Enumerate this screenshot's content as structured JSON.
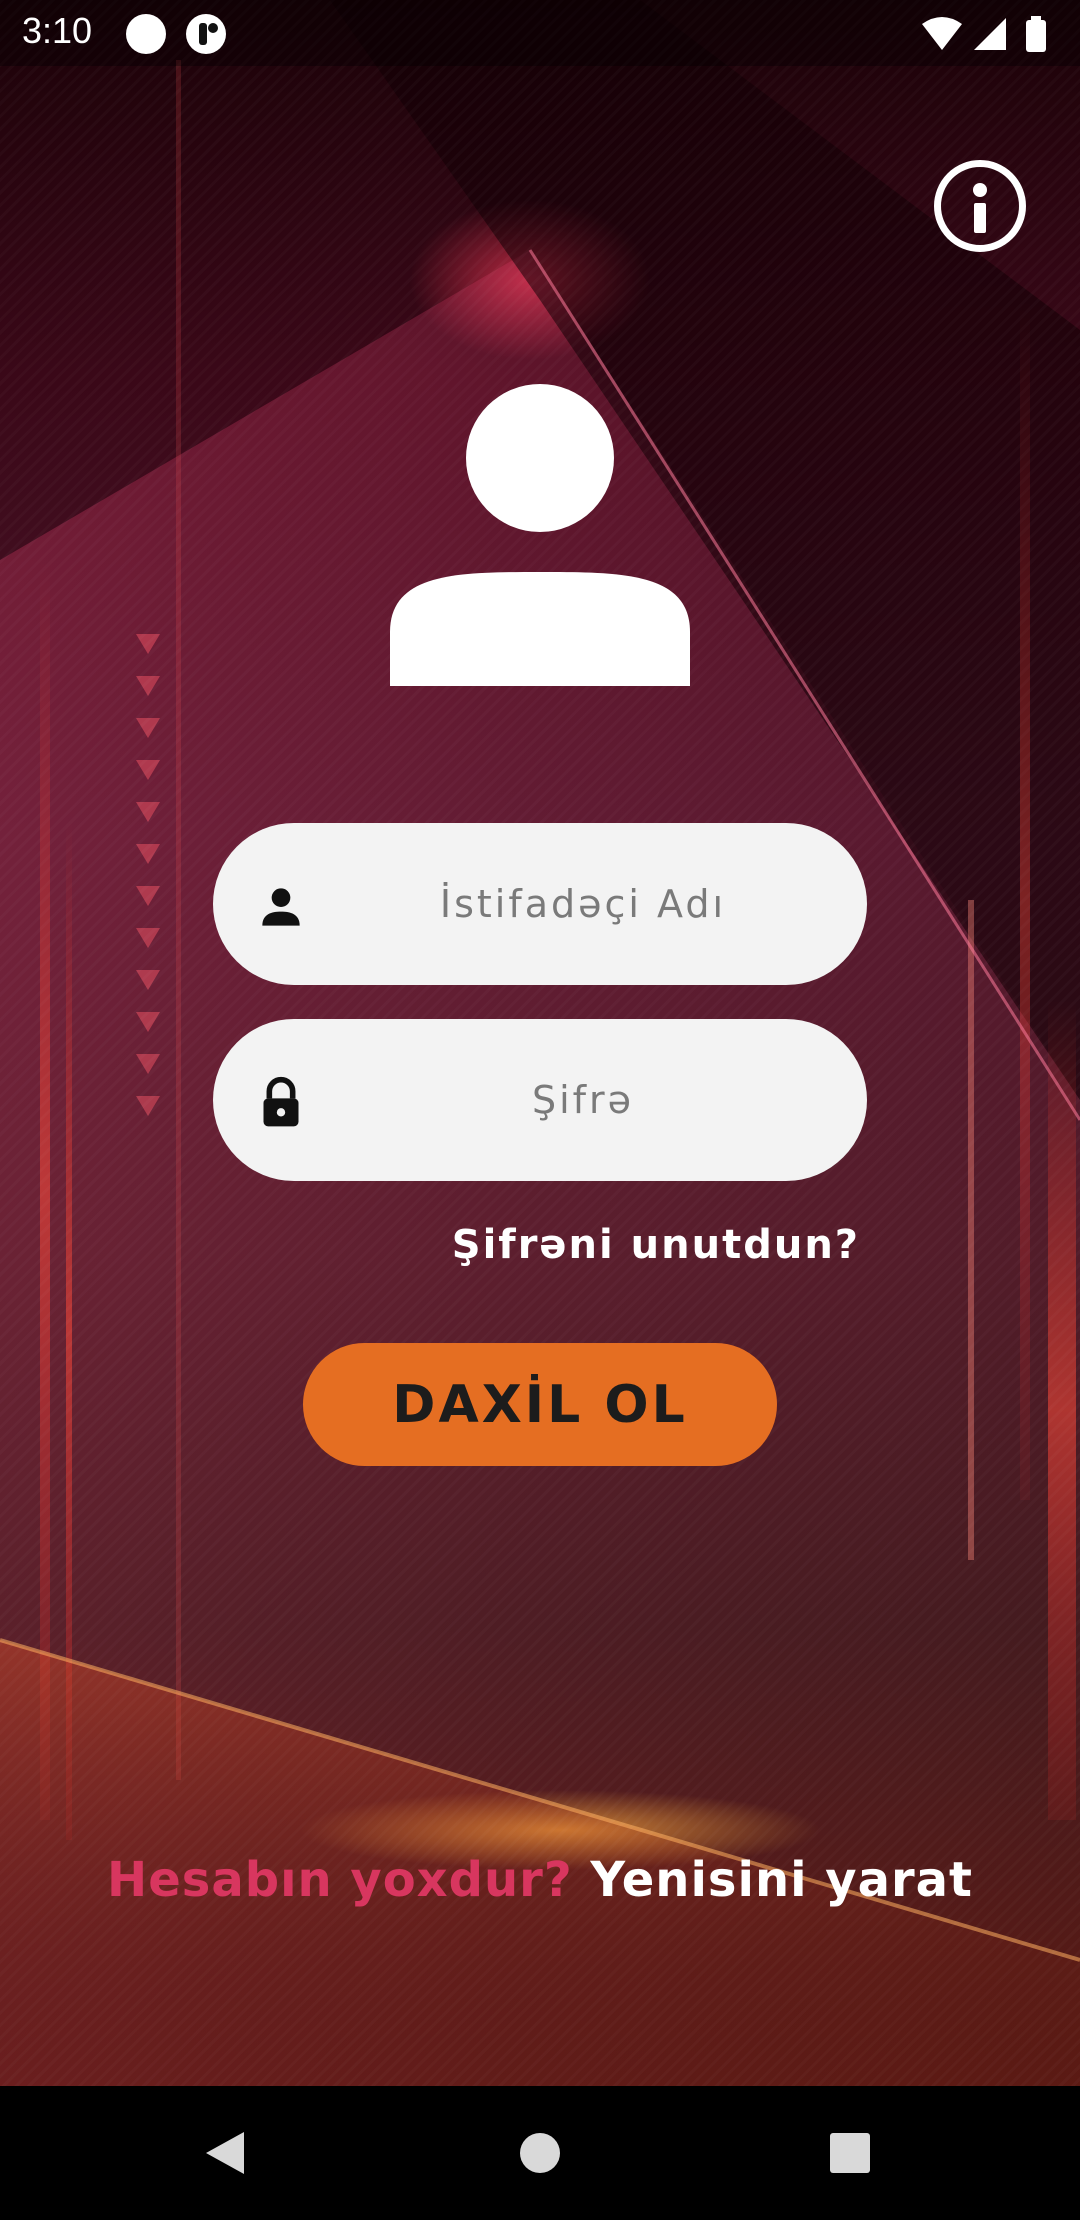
{
  "status_bar": {
    "time": "3:10",
    "icons": [
      "circle-notification-icon",
      "app-notification-icon",
      "wifi-icon",
      "signal-icon",
      "battery-icon"
    ]
  },
  "header": {
    "info_icon": "info-icon"
  },
  "avatar": {
    "icon": "user-avatar-icon"
  },
  "login_form": {
    "username": {
      "icon": "user-icon",
      "placeholder": "İstifadəçi Adı",
      "value": ""
    },
    "password": {
      "icon": "lock-icon",
      "placeholder": "Şifrə",
      "value": ""
    },
    "forgot_password": "Şifrəni unutdun?",
    "login_button": "DAXİL OL"
  },
  "signup": {
    "prompt": "Hesabın yoxdur?",
    "link": "Yenisini yarat"
  },
  "nav_bar": {
    "items": [
      "back-icon",
      "home-icon",
      "recent-apps-icon"
    ]
  },
  "colors": {
    "accent_button": "#e56e22",
    "signup_prompt": "#d8365f",
    "input_background": "#f3f3f3"
  }
}
